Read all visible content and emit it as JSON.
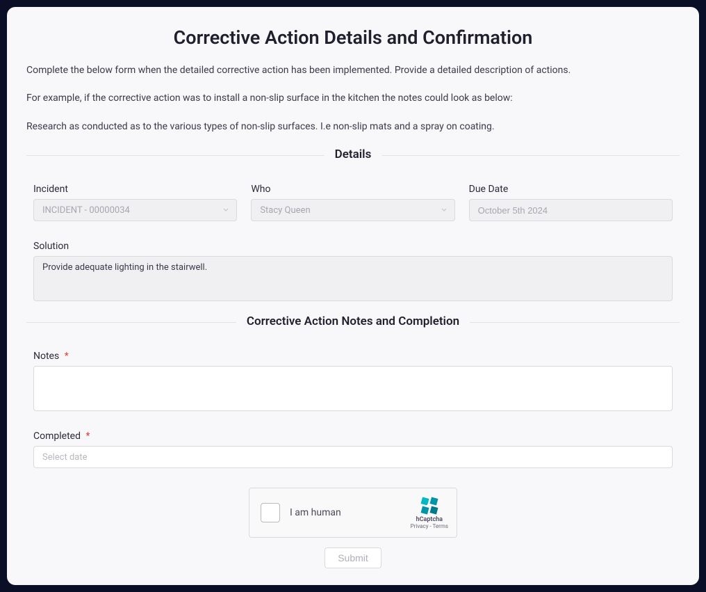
{
  "title": "Corrective Action Details and Confirmation",
  "intro": {
    "p1": "Complete the below form when the detailed corrective action has been implemented. Provide a detailed description of actions.",
    "p2": "For example, if the corrective action was to install a non-slip surface in the kitchen the notes could look as below:",
    "p3": "Research as conducted as to the various types of non-slip surfaces. I.e non-slip mats and a spray on coating."
  },
  "sections": {
    "details": "Details",
    "notes_completion": "Corrective Action Notes and Completion"
  },
  "fields": {
    "incident": {
      "label": "Incident",
      "value": "INCIDENT - 00000034"
    },
    "who": {
      "label": "Who",
      "value": "Stacy Queen"
    },
    "due_date": {
      "label": "Due Date",
      "value": "October 5th 2024"
    },
    "solution": {
      "label": "Solution",
      "value": "Provide adequate lighting in the stairwell."
    },
    "notes": {
      "label": "Notes",
      "value": ""
    },
    "completed": {
      "label": "Completed",
      "placeholder": "Select date",
      "value": ""
    }
  },
  "captcha": {
    "label": "I am human",
    "name": "hCaptcha",
    "privacy": "Privacy",
    "terms": "Terms",
    "separator": " - "
  },
  "buttons": {
    "submit": "Submit"
  },
  "required_marker": "*"
}
